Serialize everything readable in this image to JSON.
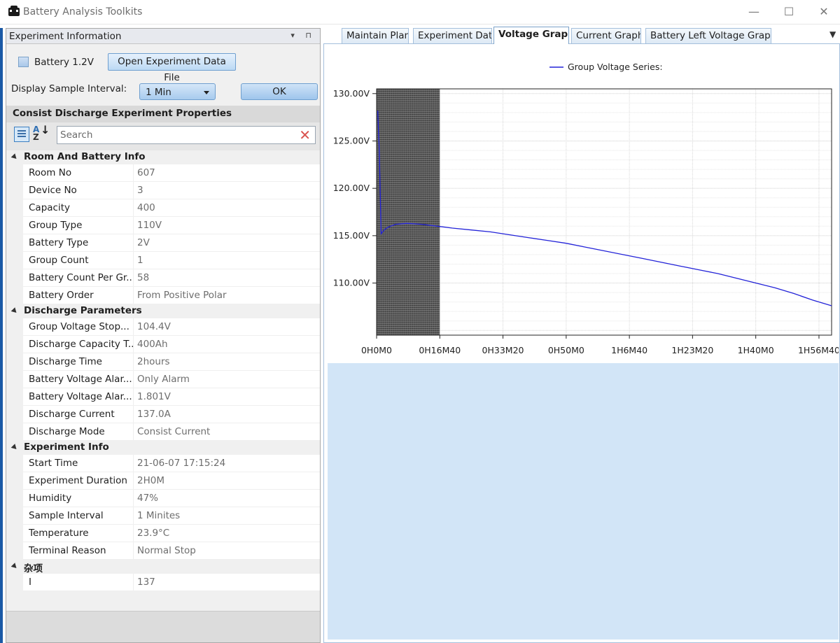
{
  "window": {
    "title": "Battery Analysis Toolkits",
    "minimize": "—",
    "maximize": "☐",
    "close": "✕"
  },
  "experiment_panel": {
    "title": "Experiment Information",
    "header_buttons": "▾ ⊓",
    "battery_checkbox_label": "Battery 1.2V",
    "battery_checkbox_checked": false,
    "open_button": "Open Experiment Data File",
    "interval_label": "Display Sample Interval:",
    "interval_value": "1 Min",
    "ok_button": "OK"
  },
  "properties": {
    "title": "Consist Discharge Experiment Properties",
    "search_placeholder": "Search",
    "categories": [
      {
        "name": "Room And Battery Info",
        "rows": [
          {
            "name": "Room No",
            "value": "607"
          },
          {
            "name": "Device No",
            "value": "3"
          },
          {
            "name": "Capacity",
            "value": "400"
          },
          {
            "name": "Group Type",
            "value": "110V"
          },
          {
            "name": "Battery Type",
            "value": "2V"
          },
          {
            "name": "Group Count",
            "value": "1"
          },
          {
            "name": "Battery Count Per Gr...",
            "value": "58"
          },
          {
            "name": "Battery Order",
            "value": "From Positive Polar"
          }
        ]
      },
      {
        "name": "Discharge Parameters",
        "rows": [
          {
            "name": "Group Voltage Stop...",
            "value": "104.4V"
          },
          {
            "name": "Discharge Capacity T...",
            "value": "400Ah"
          },
          {
            "name": "Discharge Time",
            "value": "2hours"
          },
          {
            "name": "Battery Voltage Alar...",
            "value": "Only Alarm"
          },
          {
            "name": "Battery Voltage Alar...",
            "value": "1.801V"
          },
          {
            "name": "Discharge Current",
            "value": "137.0A"
          },
          {
            "name": "Discharge Mode",
            "value": "Consist Current"
          }
        ]
      },
      {
        "name": "Experiment Info",
        "rows": [
          {
            "name": "Start Time",
            "value": "21-06-07 17:15:24"
          },
          {
            "name": "Experiment Duration",
            "value": "2H0M"
          },
          {
            "name": "Humidity",
            "value": "47%"
          },
          {
            "name": "Sample Interval",
            "value": "1 Minites"
          },
          {
            "name": "Temperature",
            "value": "23.9°C"
          },
          {
            "name": "Terminal Reason",
            "value": "Normal Stop"
          }
        ]
      },
      {
        "name": "杂项",
        "rows": [
          {
            "name": "I",
            "value": "137"
          }
        ]
      }
    ]
  },
  "tabs": [
    {
      "label": "Maintain Plan",
      "active": false
    },
    {
      "label": "Experiment Data",
      "active": false
    },
    {
      "label": "Voltage Graph",
      "active": true
    },
    {
      "label": "Current Graph",
      "active": false
    },
    {
      "label": "Battery Left Voltage Graph",
      "active": false
    }
  ],
  "tabs_menu_icon": "▼",
  "colors": {
    "series": "#2323d8",
    "panel_blue": "#d2e5f7",
    "accent_strip": "#1b5aa6"
  },
  "chart_data": {
    "type": "line",
    "legend": "Group Voltage Series:",
    "legend_position": "top-center",
    "x_unit": "minutes",
    "x_tick_labels": [
      "0H0M0",
      "0H16M40",
      "0H33M20",
      "0H50M0",
      "1H6M40",
      "1H23M20",
      "1H40M0",
      "1H56M40"
    ],
    "x_tick_values": [
      0,
      16.67,
      33.33,
      50,
      66.67,
      83.33,
      100,
      116.67
    ],
    "xlim": [
      0,
      120
    ],
    "ylim": [
      104.5,
      130.5
    ],
    "y_tick_labels": [
      "130.00V",
      "125.00V",
      "120.00V",
      "115.00V",
      "110.00V"
    ],
    "y_tick_values": [
      130,
      125,
      120,
      115,
      110
    ],
    "grid": true,
    "shaded_region_x": [
      0,
      16.67
    ],
    "series": [
      {
        "name": "Group Voltage Series:",
        "x": [
          0.3,
          0.7,
          1.2,
          2,
          3,
          5,
          8,
          12,
          16,
          20,
          25,
          30,
          35,
          40,
          45,
          50,
          55,
          60,
          65,
          70,
          75,
          80,
          85,
          90,
          95,
          100,
          105,
          110,
          115,
          120
        ],
        "y": [
          128.2,
          124.0,
          115.2,
          115.6,
          115.9,
          116.2,
          116.3,
          116.2,
          116.0,
          115.8,
          115.6,
          115.4,
          115.1,
          114.8,
          114.5,
          114.2,
          113.8,
          113.4,
          113.0,
          112.6,
          112.2,
          111.8,
          111.4,
          111.0,
          110.5,
          110.0,
          109.5,
          108.9,
          108.2,
          107.6
        ]
      }
    ]
  }
}
